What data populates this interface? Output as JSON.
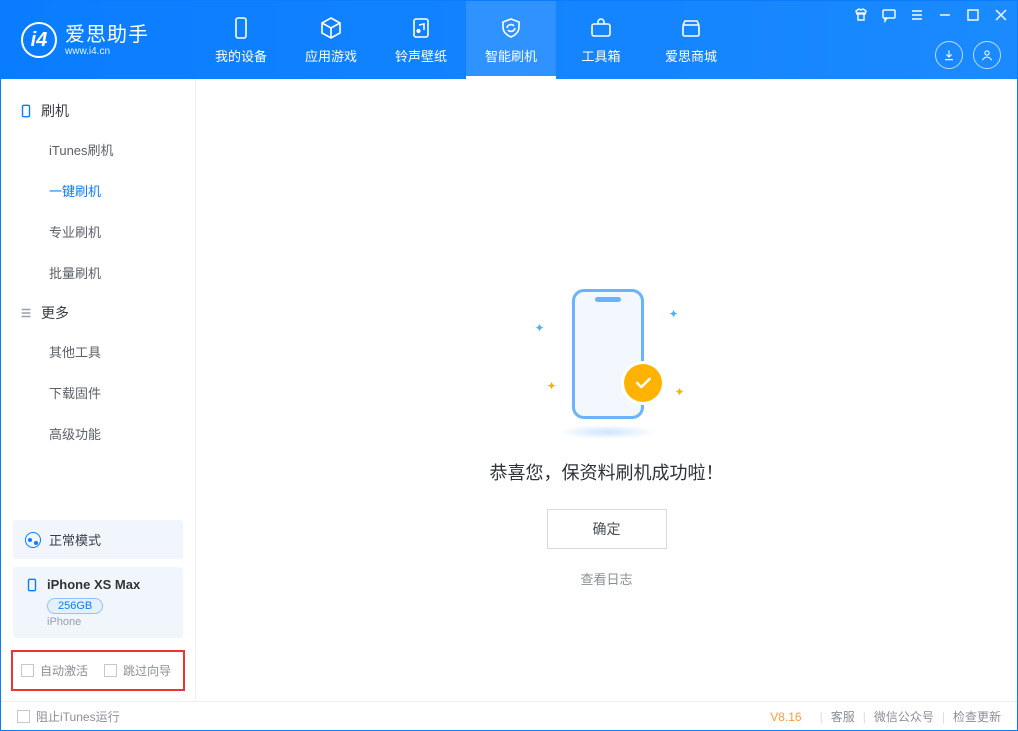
{
  "app": {
    "title": "爱思助手",
    "subtitle": "www.i4.cn"
  },
  "nav": {
    "items": [
      {
        "label": "我的设备"
      },
      {
        "label": "应用游戏"
      },
      {
        "label": "铃声壁纸"
      },
      {
        "label": "智能刷机"
      },
      {
        "label": "工具箱"
      },
      {
        "label": "爱思商城"
      }
    ]
  },
  "sidebar": {
    "sections": [
      {
        "title": "刷机",
        "items": [
          {
            "label": "iTunes刷机"
          },
          {
            "label": "一键刷机"
          },
          {
            "label": "专业刷机"
          },
          {
            "label": "批量刷机"
          }
        ]
      },
      {
        "title": "更多",
        "items": [
          {
            "label": "其他工具"
          },
          {
            "label": "下载固件"
          },
          {
            "label": "高级功能"
          }
        ]
      }
    ],
    "status_mode": "正常模式",
    "device": {
      "name": "iPhone XS Max",
      "storage": "256GB",
      "type": "iPhone"
    },
    "auto_activate": "自动激活",
    "skip_guide": "跳过向导"
  },
  "main": {
    "success_title": "恭喜您，保资料刷机成功啦！",
    "ok_button": "确定",
    "view_log": "查看日志"
  },
  "footer": {
    "block_itunes": "阻止iTunes运行",
    "version": "V8.16",
    "links": [
      "客服",
      "微信公众号",
      "检查更新"
    ]
  }
}
